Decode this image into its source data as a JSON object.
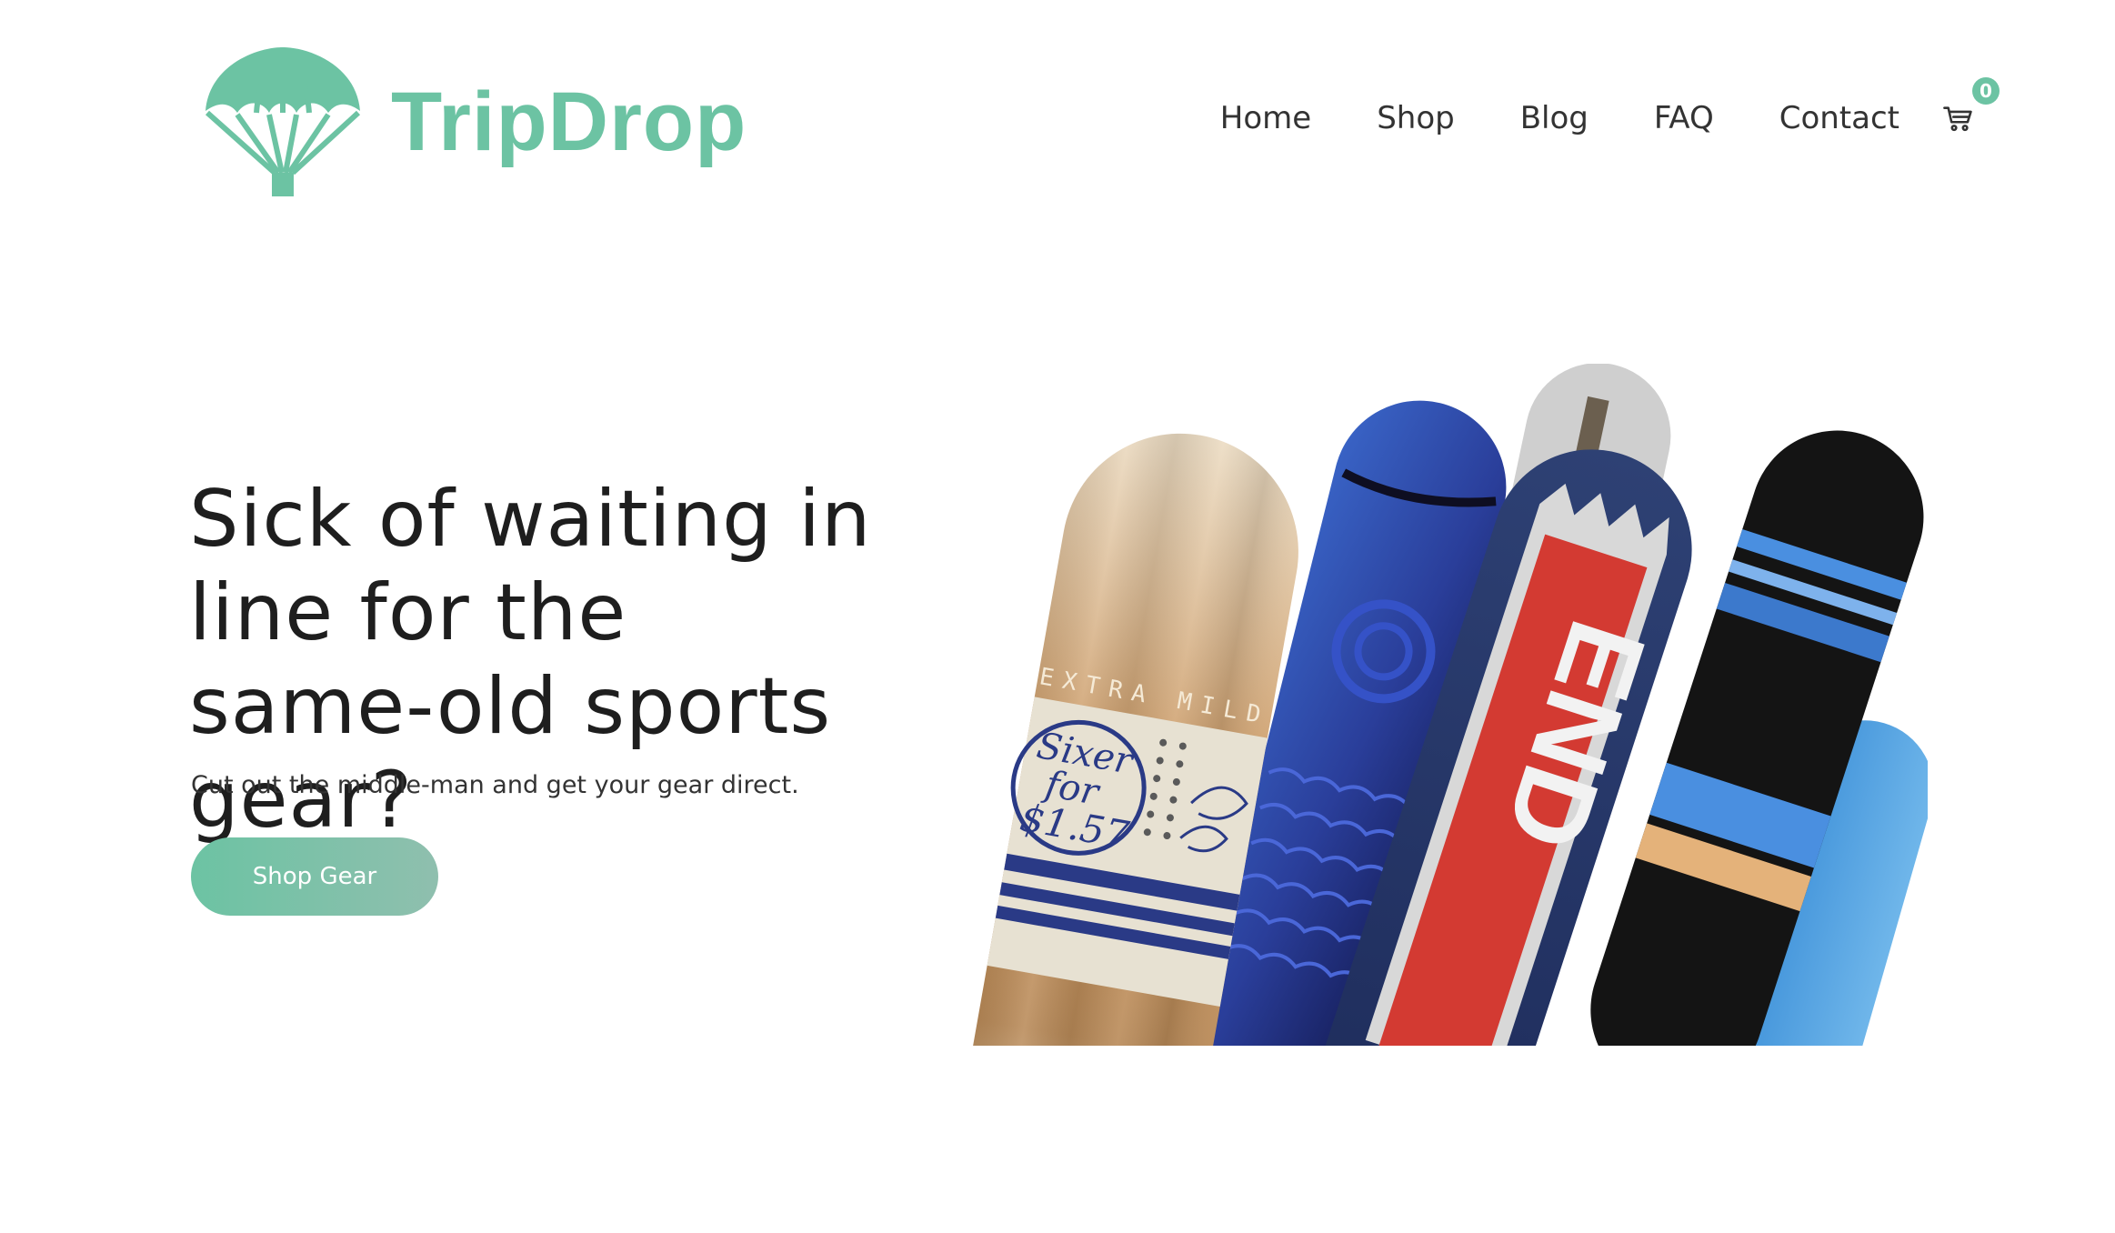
{
  "brand": {
    "name": "TripDrop",
    "logo_icon": "parachute-icon",
    "accent_color": "#6cc3a3"
  },
  "nav": {
    "items": [
      {
        "label": "Home"
      },
      {
        "label": "Shop"
      },
      {
        "label": "Blog"
      },
      {
        "label": "FAQ"
      },
      {
        "label": "Contact"
      }
    ],
    "cart": {
      "icon": "cart-icon",
      "count": "0"
    }
  },
  "hero": {
    "title": "Sick of waiting in line for the same-old sports gear?",
    "subtitle": "Cut out the middle-man and get your gear direct.",
    "cta_label": "Shop Gear",
    "image_alt": "snowboards-image",
    "board_texts": {
      "extra_mild": "EXTRA MILD",
      "sixer": "Sixer",
      "for": "for",
      "price": "$1.57",
      "end": "END"
    }
  }
}
